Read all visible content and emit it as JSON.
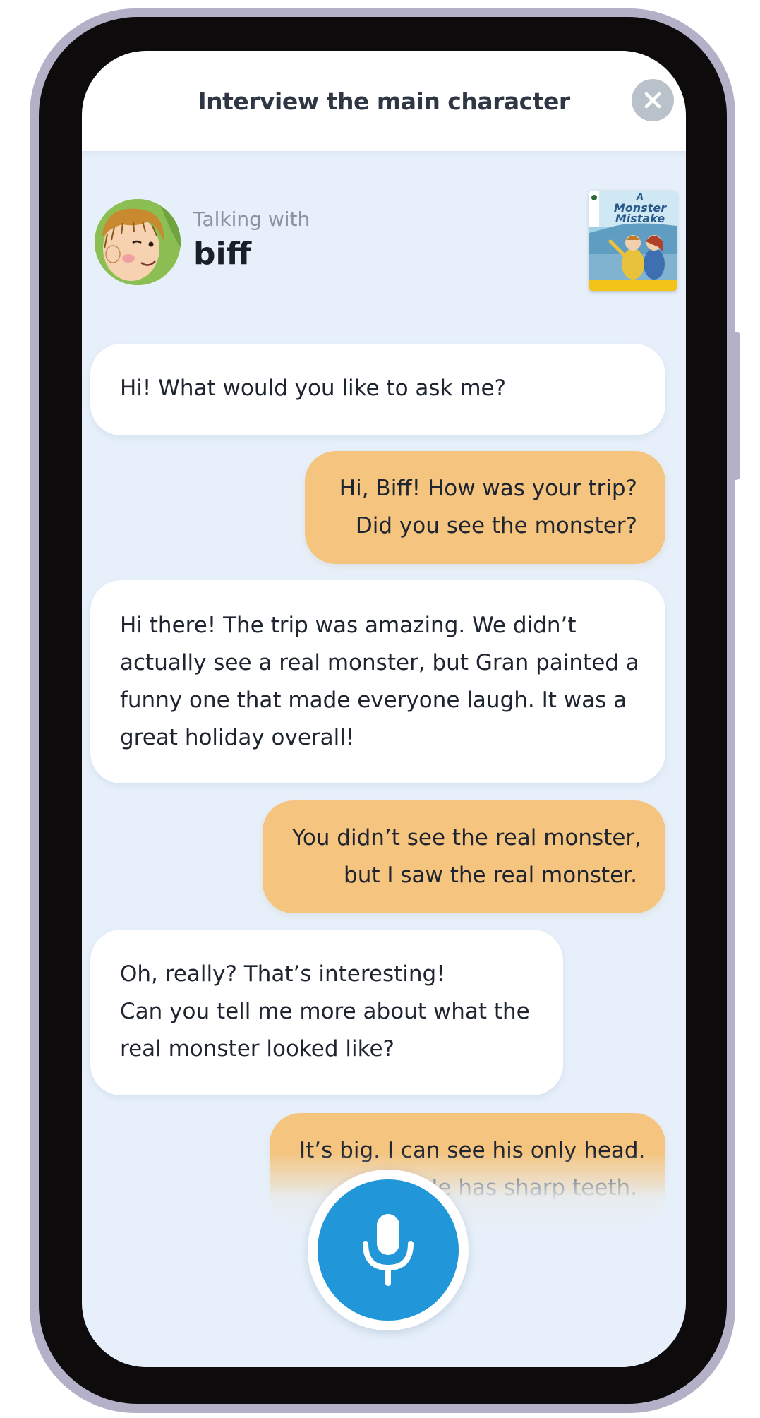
{
  "header": {
    "title": "Interview the main character",
    "close_icon": "close-icon"
  },
  "character": {
    "talking_label": "Talking with",
    "name": "biff",
    "avatar_icon": "biff-avatar"
  },
  "book": {
    "cover_title_line1": "A",
    "cover_title_line2": "Monster",
    "cover_title_line3": "Mistake"
  },
  "messages": [
    {
      "role": "bot",
      "lines": [
        "Hi! What would you like to ask me?"
      ]
    },
    {
      "role": "user",
      "lines": [
        "Hi,  Biff! How was your trip?",
        "Did you see the monster?"
      ]
    },
    {
      "role": "bot",
      "lines": [
        "Hi there! The trip was amazing. We didn’t",
        "actually see a real monster, but Gran painted a",
        "funny one that made everyone laugh. It was a",
        "great holiday overall!"
      ]
    },
    {
      "role": "user",
      "lines": [
        "You didn’t see the real monster,",
        "but I saw the real monster."
      ]
    },
    {
      "role": "bot",
      "lines": [
        "Oh, really? That’s interesting!",
        "Can you tell me more about what the",
        "real monster looked like?"
      ]
    },
    {
      "role": "user",
      "lines": [
        "It’s big. I can see his only head.",
        "He has sharp teeth."
      ]
    }
  ],
  "mic": {
    "icon": "microphone-icon"
  },
  "colors": {
    "screen_bg": "#e7f0fa",
    "user_bubble": "#f5c47e",
    "bot_bubble": "#ffffff",
    "mic": "#2196d9",
    "close_btn": "#b9c1ca",
    "phone_frame": "#b4b0c7"
  }
}
